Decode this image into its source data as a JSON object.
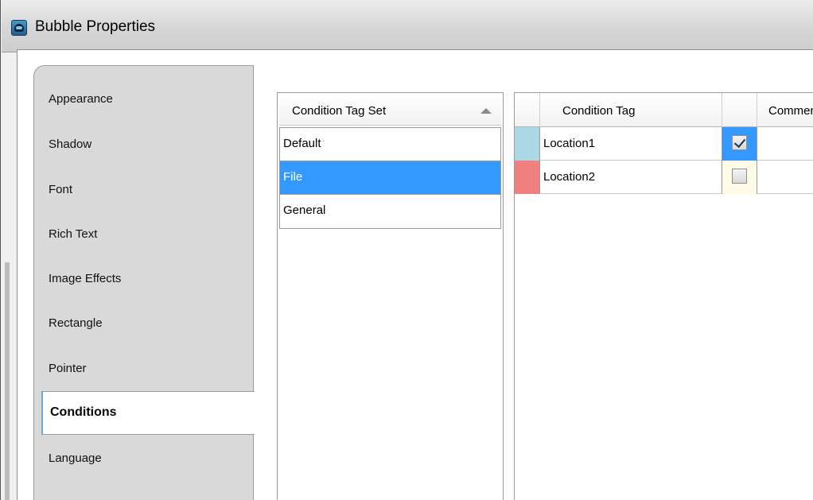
{
  "window": {
    "title": "Bubble Properties",
    "icon": "bubble-app-icon"
  },
  "categories": [
    "Appearance",
    "Shadow",
    "Font",
    "Rich Text",
    "Image Effects",
    "Rectangle",
    "Pointer",
    "Conditions",
    "Language"
  ],
  "selected_category": "Conditions",
  "tag_sets": {
    "header": "Condition Tag Set",
    "sort_icon": "sort-ascending-icon",
    "items": [
      "Default",
      "File",
      "General"
    ],
    "selected": "File"
  },
  "condition_tags": {
    "headers": {
      "tag": "Condition Tag",
      "check": "",
      "comment": "Comment"
    },
    "rows": [
      {
        "name": "Location1",
        "color": "#add8e6",
        "checked": true,
        "comment": ""
      },
      {
        "name": "Location2",
        "color": "#f08080",
        "checked": false,
        "comment": ""
      }
    ]
  },
  "colors": {
    "selection": "#3399ff",
    "selected_cell": "#3399ff",
    "unchecked_cell": "#fffbe6"
  }
}
